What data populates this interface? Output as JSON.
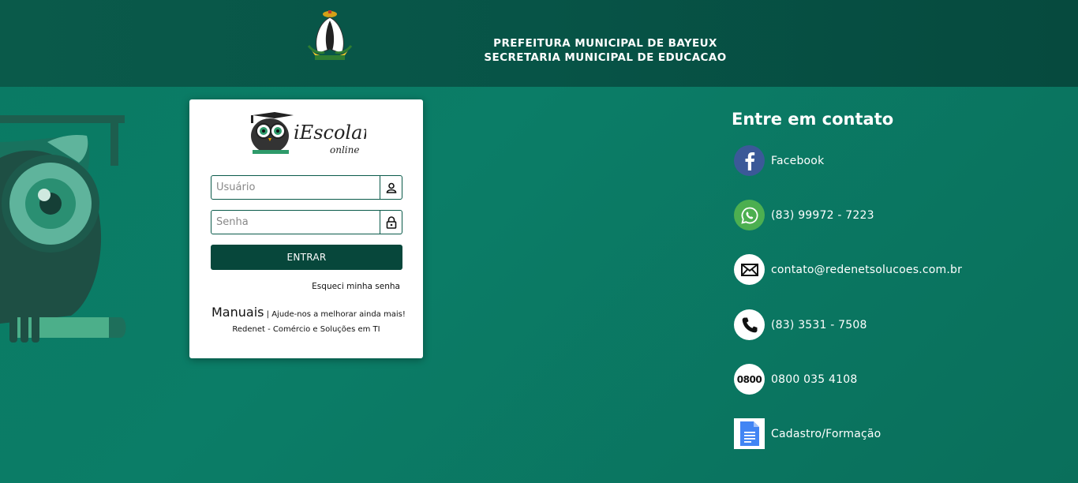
{
  "header": {
    "line1": "PREFEITURA MUNICIPAL DE BAYEUX",
    "line2": "SECRETARIA MUNICIPAL DE EDUCACAO"
  },
  "login": {
    "logo_text": "iEscolar",
    "logo_sub": "online",
    "user_placeholder": "Usuário",
    "user_icon": "person-icon",
    "password_placeholder": "Senha",
    "password_icon": "lock-icon",
    "submit_label": "ENTRAR",
    "forgot_label": "Esqueci minha senha",
    "manuals_label": "Manuais",
    "manuals_tagline": "| Ajude-nos a melhorar ainda mais!",
    "company": "Redenet - Comércio e Soluções em TI"
  },
  "contact": {
    "title": "Entre em contato",
    "items": [
      {
        "label": "Facebook",
        "icon": "facebook-icon",
        "color": "#3b5998"
      },
      {
        "label": "(83) 99972 - 7223",
        "icon": "whatsapp-icon",
        "color": "#4caf50"
      },
      {
        "label": "contato@redenetsolucoes.com.br",
        "icon": "mail-icon",
        "color": "#ffffff"
      },
      {
        "label": "(83) 3531 - 7508",
        "icon": "phone-icon",
        "color": "#ffffff"
      },
      {
        "label": "0800 035 4108",
        "icon": "0800-icon",
        "badge": "0800",
        "color": "#ffffff"
      },
      {
        "label": "Cadastro/Formação",
        "icon": "google-docs-icon",
        "color": "#4285f4"
      }
    ]
  },
  "colors": {
    "header_bg": "#075447",
    "page_bg": "#0b7d67",
    "button_bg": "#07473b"
  }
}
